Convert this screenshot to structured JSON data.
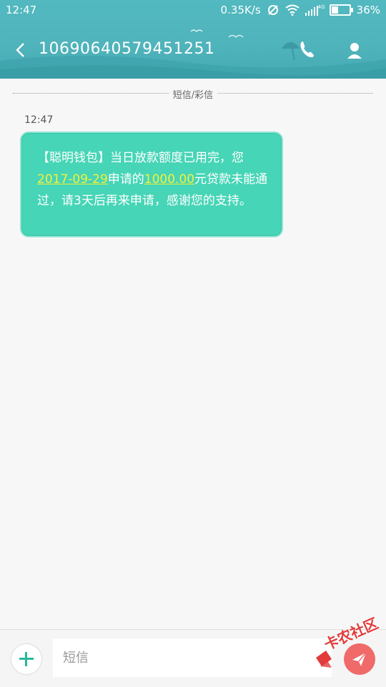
{
  "status_bar": {
    "time": "12:47",
    "network_speed": "0.35K/s",
    "signal_label": "4G",
    "battery_percent": "36%"
  },
  "header": {
    "title": "10690640579451251",
    "icons": [
      "back-arrow-icon",
      "phone-icon",
      "contact-icon"
    ]
  },
  "conversation": {
    "channel_label": "短信/彩信",
    "message_time": "12:47",
    "message": {
      "part1": "【聪明钱包】当日放款额度已用完，您",
      "date": "2017-09-29",
      "part2": "申请的",
      "amount": "1000.00",
      "part3": "元贷款未能通过，请3天后再来申请，感谢您的支持。"
    }
  },
  "composer": {
    "placeholder": "短信",
    "send_icon": "send-icon",
    "add_icon": "plus-icon"
  },
  "watermark": {
    "text": "卡农社区"
  },
  "colors": {
    "header": "#4fb3bb",
    "bubble": "#46d5b6",
    "highlight": "#f4f23a",
    "send": "#f06a6a",
    "plus": "#28b89d"
  }
}
